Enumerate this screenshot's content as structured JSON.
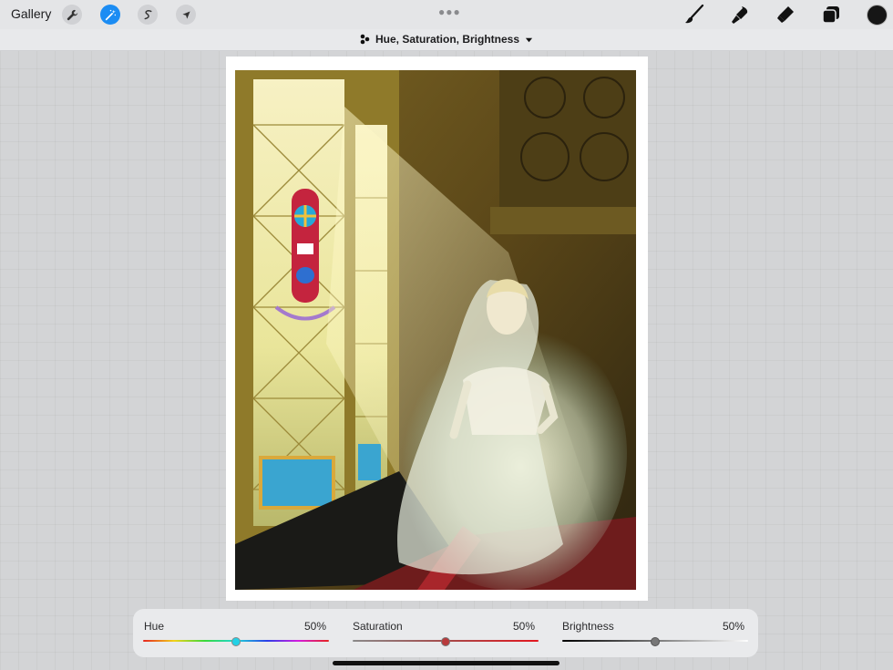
{
  "toolbar": {
    "gallery_label": "Gallery",
    "left_tools": [
      {
        "icon": "wrench-icon"
      },
      {
        "icon": "magic-wand-icon",
        "active": true
      },
      {
        "icon": "selection-s-icon"
      },
      {
        "icon": "transform-arrow-icon"
      }
    ],
    "right_tools": [
      {
        "icon": "brush-icon"
      },
      {
        "icon": "smudge-icon"
      },
      {
        "icon": "eraser-icon"
      },
      {
        "icon": "layers-icon"
      }
    ],
    "current_color": "#161616",
    "accent": "#1b8cf3"
  },
  "adjustment": {
    "title": "Hue, Saturation, Brightness"
  },
  "sliders": [
    {
      "label": "Hue",
      "value": "50%",
      "level": 0.5
    },
    {
      "label": "Saturation",
      "value": "50%",
      "level": 0.5
    },
    {
      "label": "Brightness",
      "value": "50%",
      "level": 0.5
    }
  ]
}
